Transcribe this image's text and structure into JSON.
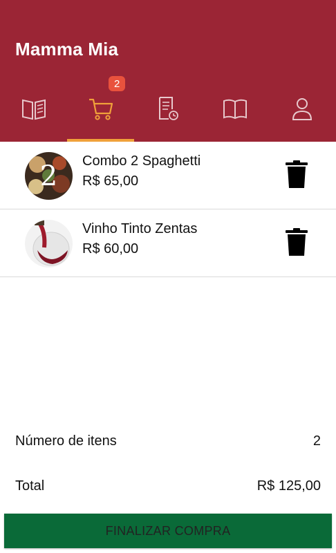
{
  "header": {
    "title": "Mamma Mia",
    "background": "#9b2535",
    "tabs": [
      {
        "icon": "menu-book-icon",
        "active": false
      },
      {
        "icon": "cart-icon",
        "active": true,
        "badge": "2"
      },
      {
        "icon": "order-history-icon",
        "active": false
      },
      {
        "icon": "open-book-icon",
        "active": false
      },
      {
        "icon": "profile-icon",
        "active": false
      }
    ],
    "active_color": "#f0a13a"
  },
  "cart": {
    "items": [
      {
        "name": "Combo 2 Spaghetti",
        "price": "R$ 65,00",
        "thumb_text": "2"
      },
      {
        "name": "Vinho Tinto Zentas",
        "price": "R$ 60,00"
      }
    ]
  },
  "summary": {
    "count_label": "Número de itens",
    "count_value": "2",
    "total_label": "Total",
    "total_value": "R$ 125,00"
  },
  "checkout": {
    "label": "FINALIZAR COMPRA",
    "color": "#0a6a38"
  }
}
